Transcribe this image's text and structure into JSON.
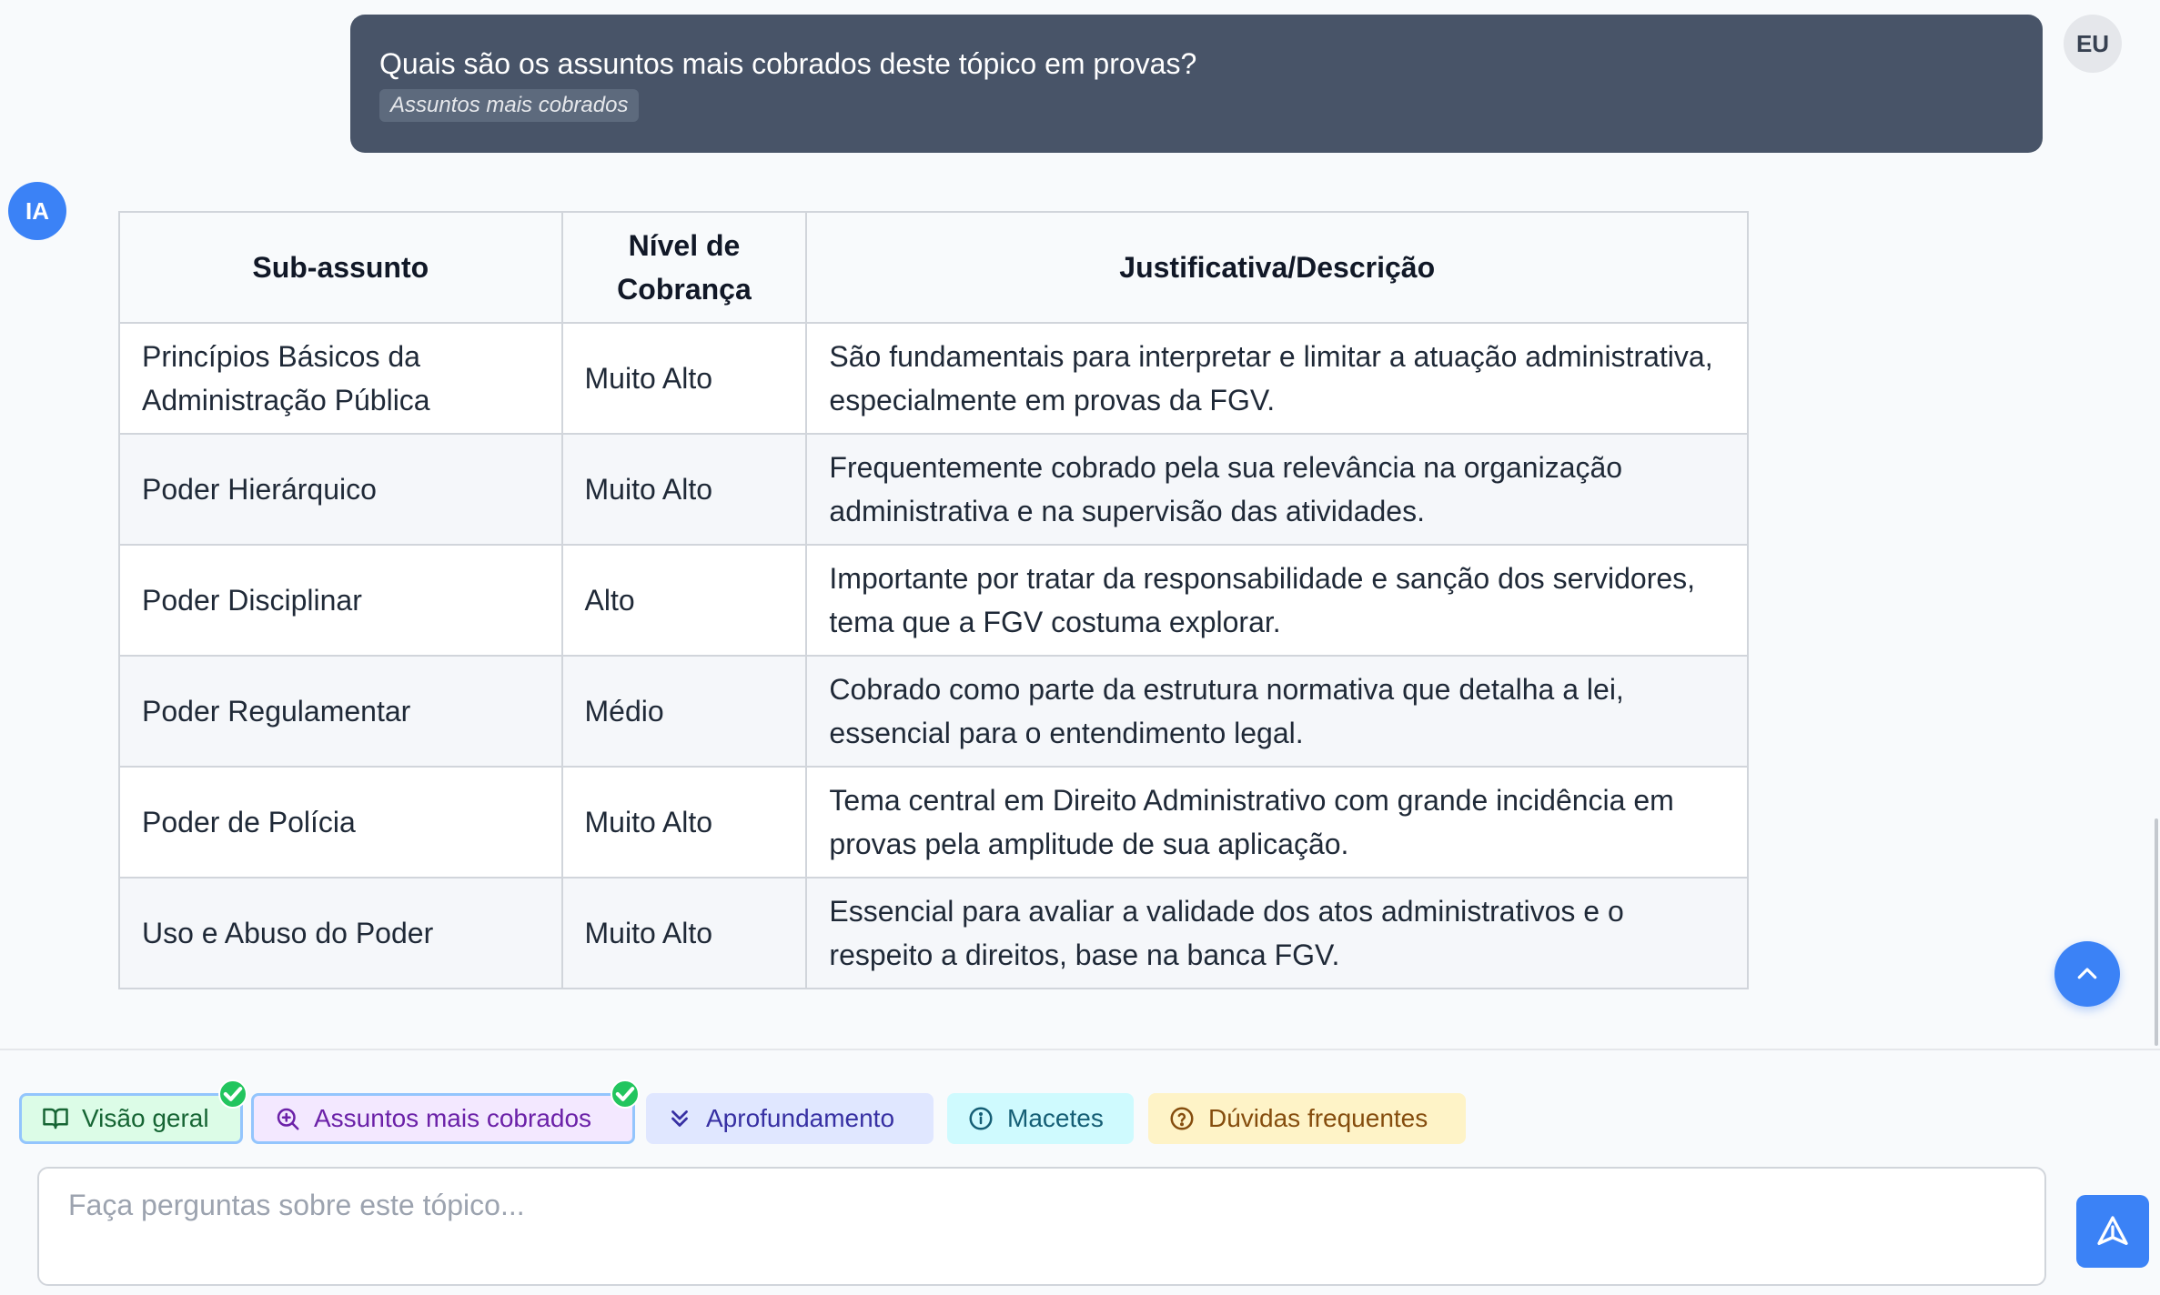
{
  "user_message": {
    "question": "Quais são os assuntos mais cobrados deste tópico em provas?",
    "tag": "Assuntos mais cobrados",
    "avatar": "EU"
  },
  "ai_message": {
    "avatar": "IA",
    "table": {
      "headers": [
        "Sub-assunto",
        "Nível de Cobrança",
        "Justificativa/Descrição"
      ],
      "rows": [
        [
          "Princípios Básicos da Administração Pública",
          "Muito Alto",
          "São fundamentais para interpretar e limitar a atuação administrativa, especialmente em provas da FGV."
        ],
        [
          "Poder Hierárquico",
          "Muito Alto",
          "Frequentemente cobrado pela sua relevância na organização administrativa e na supervisão das atividades."
        ],
        [
          "Poder Disciplinar",
          "Alto",
          "Importante por tratar da responsabilidade e sanção dos servidores, tema que a FGV costuma explorar."
        ],
        [
          "Poder Regulamentar",
          "Médio",
          "Cobrado como parte da estrutura normativa que detalha a lei, essencial para o entendimento legal."
        ],
        [
          "Poder de Polícia",
          "Muito Alto",
          "Tema central em Direito Administrativo com grande incidência em provas pela amplitude de sua aplicação."
        ],
        [
          "Uso e Abuso do Poder",
          "Muito Alto",
          "Essencial para avaliar a validade dos atos administrativos e o respeito a direitos, base na banca FGV."
        ]
      ]
    }
  },
  "quick_actions": [
    {
      "label": "Visão geral",
      "icon": "book-open-icon",
      "completed": true
    },
    {
      "label": "Assuntos mais cobrados",
      "icon": "search-plus-icon",
      "completed": true
    },
    {
      "label": "Aprofundamento",
      "icon": "chevrons-down-icon",
      "completed": false
    },
    {
      "label": "Macetes",
      "icon": "info-icon",
      "completed": false
    },
    {
      "label": "Dúvidas frequentes",
      "icon": "help-circle-icon",
      "completed": false
    }
  ],
  "composer": {
    "placeholder": "Faça perguntas sobre este tópico...",
    "value": ""
  },
  "colors": {
    "accent": "#3b82f6",
    "user_bubble": "#485468",
    "chip_visao": "#dcfce7",
    "chip_assuntos": "#f3e8ff",
    "chip_aprofundamento": "#e0e7ff",
    "chip_macetes": "#cffafe",
    "chip_duvidas": "#fef3c7",
    "check": "#22c55e"
  }
}
